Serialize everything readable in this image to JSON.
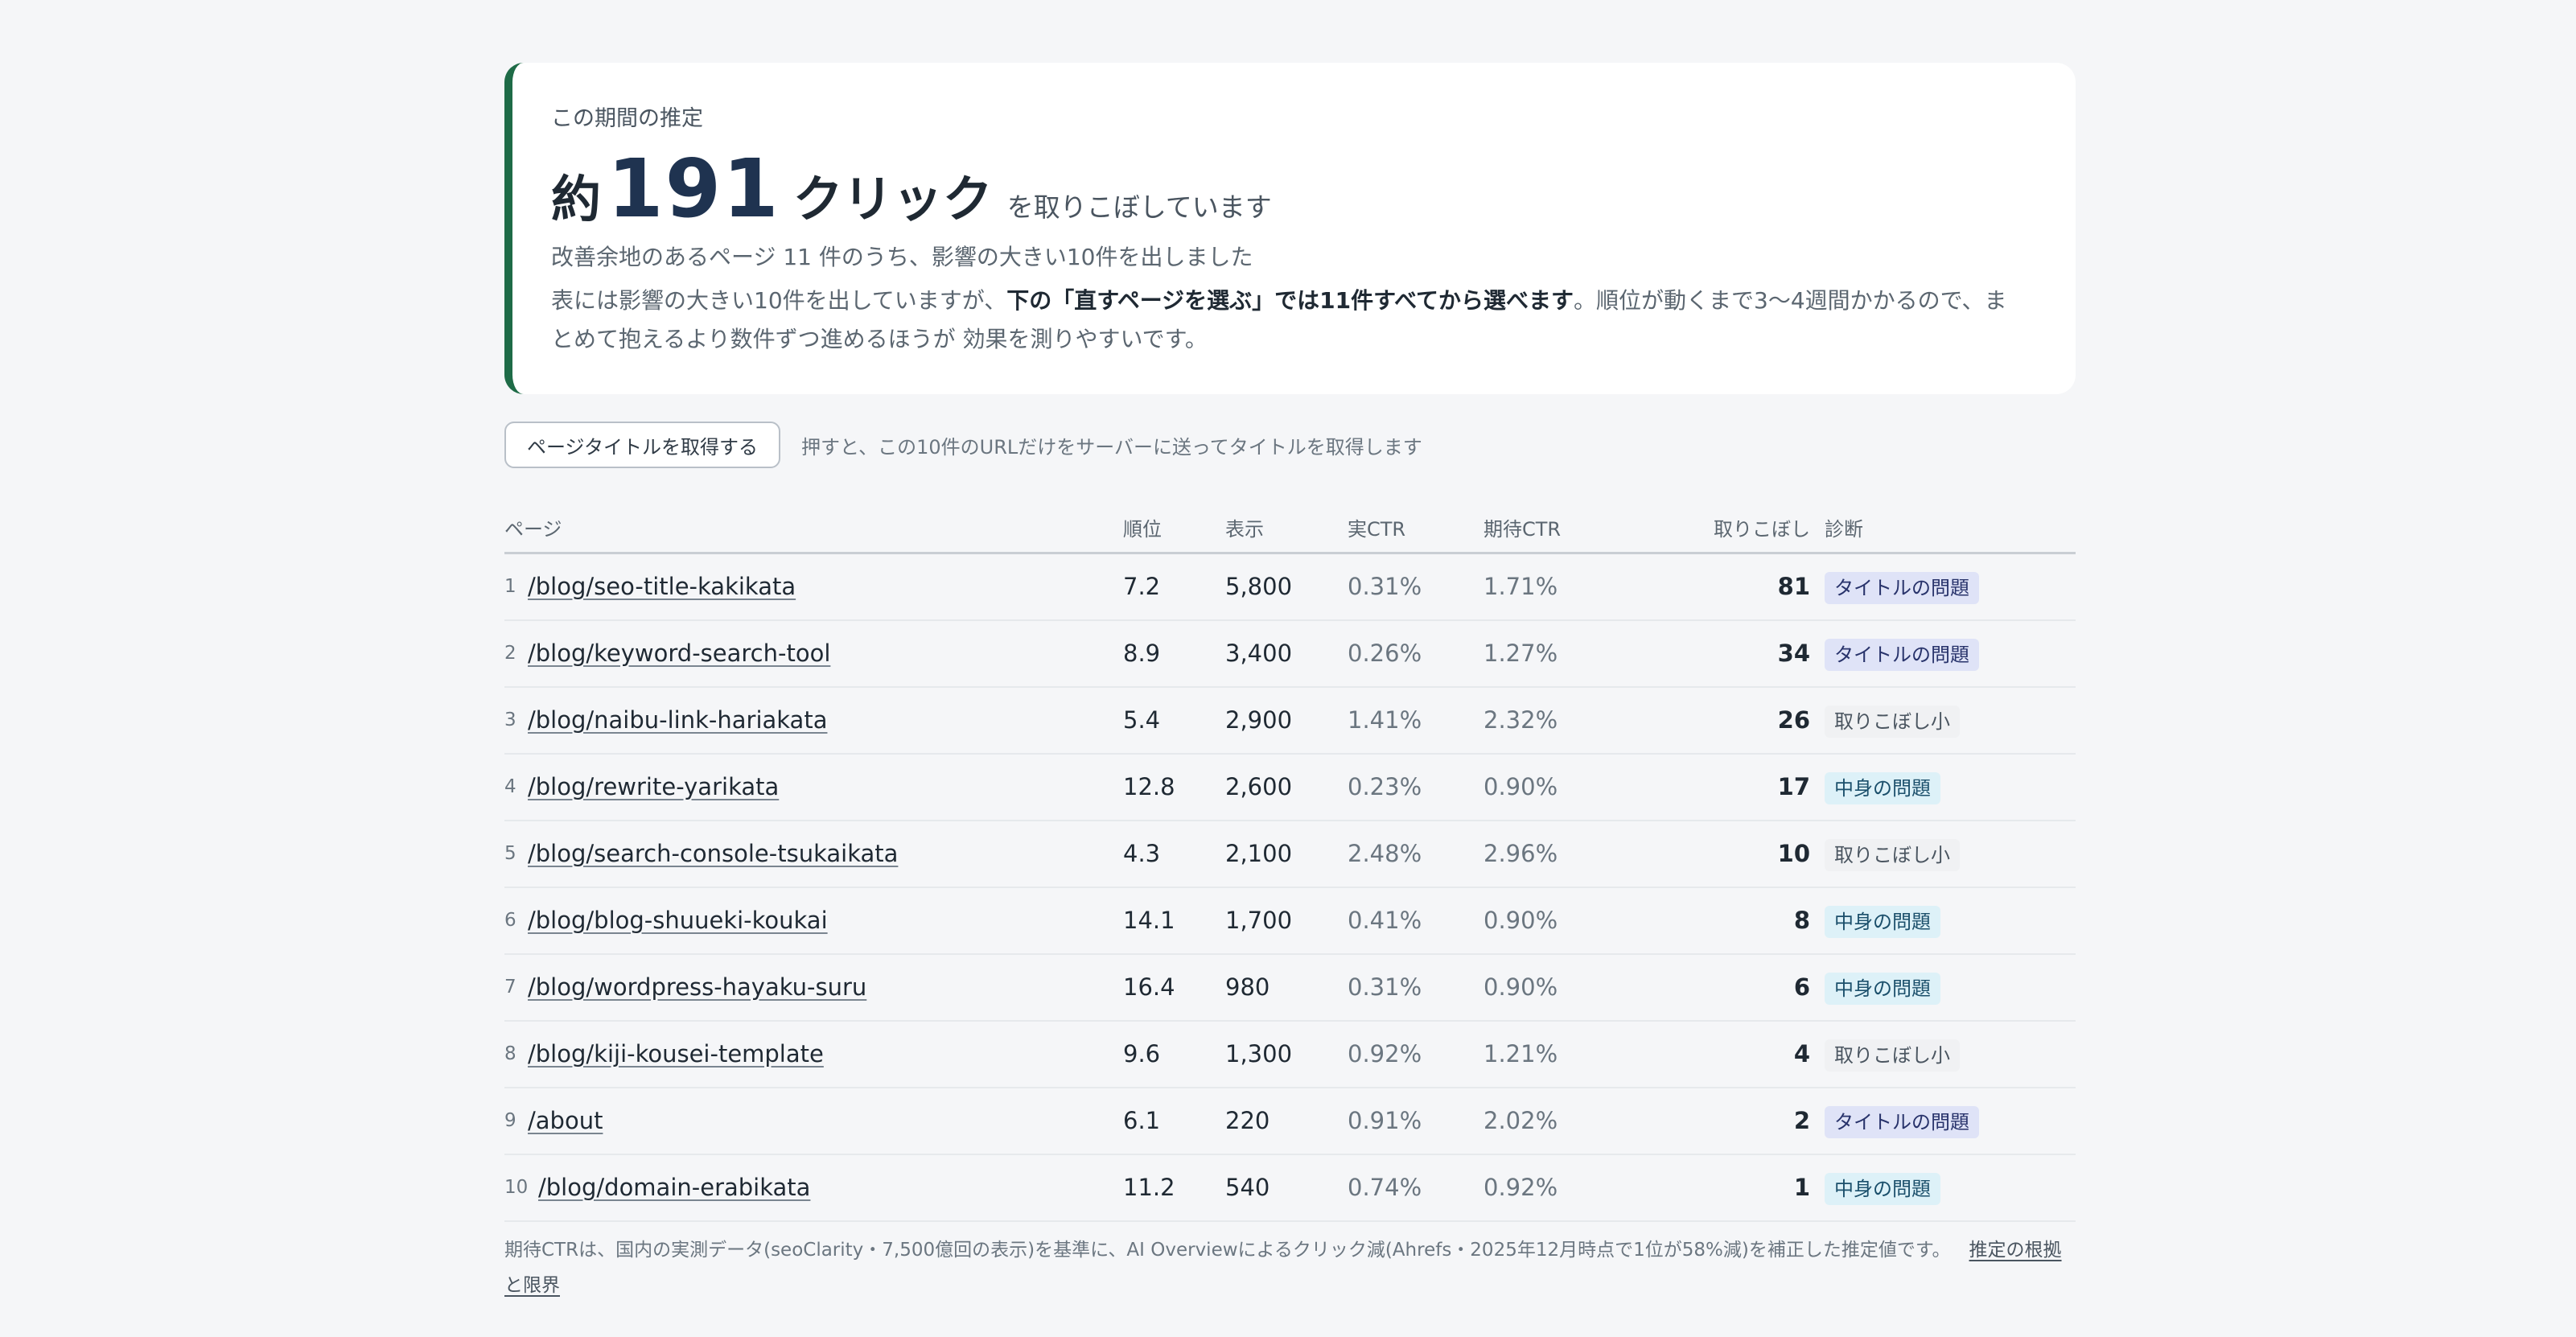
{
  "summary": {
    "label": "この期間の推定",
    "headline_prefix": "約",
    "headline_number": "191",
    "headline_unit": "クリック",
    "headline_suffix": "を取りこぼしています",
    "subtext": "改善余地のあるページ 11 件のうち、影響の大きい10件を出しました",
    "note_part1": "表には影響の大きい10件を出していますが、",
    "note_bold": "下の「直すページを選ぶ」では11件すべてから選べます",
    "note_part2": "。順位が動くまで3〜4週間かかるので、まとめて抱えるより数件ずつ進めるほうが 効果を測りやすいです。",
    "accent_color": "#1e6b47"
  },
  "fetch": {
    "button_label": "ページタイトルを取得する",
    "hint": "押すと、この10件のURLだけをサーバーに送ってタイトルを取得します"
  },
  "table": {
    "headers": {
      "page": "ページ",
      "rank": "順位",
      "impressions": "表示",
      "actual_ctr": "実CTR",
      "expected_ctr": "期待CTR",
      "lost": "取りこぼし",
      "diagnosis": "診断"
    },
    "rows": [
      {
        "num": "1",
        "page": "/blog/seo-title-kakikata",
        "rank": "7.2",
        "impressions": "5,800",
        "actual_ctr": "0.31%",
        "expected_ctr": "1.71%",
        "lost": "81",
        "diagnosis": "タイトルの問題",
        "diagnosis_type": "title"
      },
      {
        "num": "2",
        "page": "/blog/keyword-search-tool",
        "rank": "8.9",
        "impressions": "3,400",
        "actual_ctr": "0.26%",
        "expected_ctr": "1.27%",
        "lost": "34",
        "diagnosis": "タイトルの問題",
        "diagnosis_type": "title"
      },
      {
        "num": "3",
        "page": "/blog/naibu-link-hariakata",
        "rank": "5.4",
        "impressions": "2,900",
        "actual_ctr": "1.41%",
        "expected_ctr": "2.32%",
        "lost": "26",
        "diagnosis": "取りこぼし小",
        "diagnosis_type": "small"
      },
      {
        "num": "4",
        "page": "/blog/rewrite-yarikata",
        "rank": "12.8",
        "impressions": "2,600",
        "actual_ctr": "0.23%",
        "expected_ctr": "0.90%",
        "lost": "17",
        "diagnosis": "中身の問題",
        "diagnosis_type": "content"
      },
      {
        "num": "5",
        "page": "/blog/search-console-tsukaikata",
        "rank": "4.3",
        "impressions": "2,100",
        "actual_ctr": "2.48%",
        "expected_ctr": "2.96%",
        "lost": "10",
        "diagnosis": "取りこぼし小",
        "diagnosis_type": "small"
      },
      {
        "num": "6",
        "page": "/blog/blog-shuueki-koukai",
        "rank": "14.1",
        "impressions": "1,700",
        "actual_ctr": "0.41%",
        "expected_ctr": "0.90%",
        "lost": "8",
        "diagnosis": "中身の問題",
        "diagnosis_type": "content"
      },
      {
        "num": "7",
        "page": "/blog/wordpress-hayaku-suru",
        "rank": "16.4",
        "impressions": "980",
        "actual_ctr": "0.31%",
        "expected_ctr": "0.90%",
        "lost": "6",
        "diagnosis": "中身の問題",
        "diagnosis_type": "content"
      },
      {
        "num": "8",
        "page": "/blog/kiji-kousei-template",
        "rank": "9.6",
        "impressions": "1,300",
        "actual_ctr": "0.92%",
        "expected_ctr": "1.21%",
        "lost": "4",
        "diagnosis": "取りこぼし小",
        "diagnosis_type": "small"
      },
      {
        "num": "9",
        "page": "/about",
        "rank": "6.1",
        "impressions": "220",
        "actual_ctr": "0.91%",
        "expected_ctr": "2.02%",
        "lost": "2",
        "diagnosis": "タイトルの問題",
        "diagnosis_type": "title"
      },
      {
        "num": "10",
        "page": "/blog/domain-erabikata",
        "rank": "11.2",
        "impressions": "540",
        "actual_ctr": "0.74%",
        "expected_ctr": "0.92%",
        "lost": "1",
        "diagnosis": "中身の問題",
        "diagnosis_type": "content"
      }
    ]
  },
  "footer": {
    "note": "期待CTRは、国内の実測データ(seoClarity・7,500億回の表示)を基準に、AI Overviewによるクリック減(Ahrefs・2025年12月時点で1位が58%減)を補正した推定値です。",
    "link": "推定の根拠と限界"
  }
}
